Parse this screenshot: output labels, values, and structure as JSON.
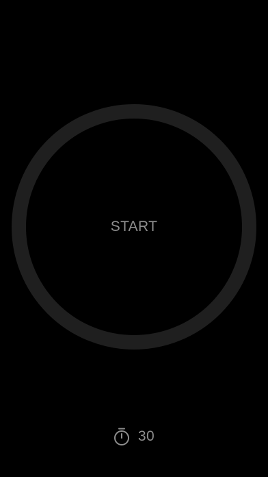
{
  "main": {
    "start_label": "START"
  },
  "timer": {
    "icon": "stopwatch-icon",
    "value": "30"
  },
  "colors": {
    "background": "#000000",
    "ring": "#1f1f1f",
    "text": "#8e8e8e"
  }
}
